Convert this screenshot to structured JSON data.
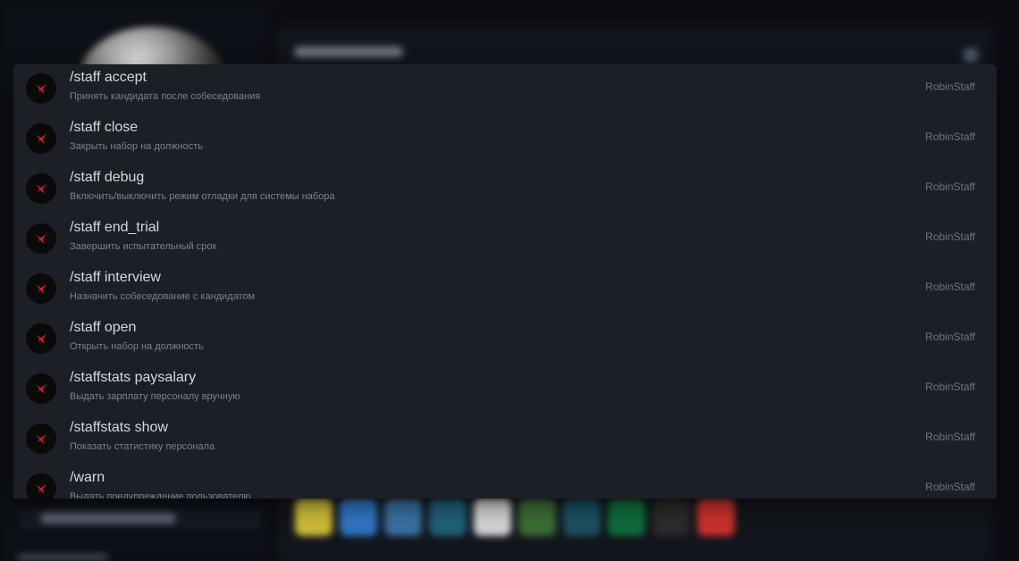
{
  "autocomplete": {
    "commands": [
      {
        "name": "/staff accept",
        "description": "Принять кандидата после собеседования",
        "source": "RobinStaff"
      },
      {
        "name": "/staff close",
        "description": "Закрыть набор на должность",
        "source": "RobinStaff"
      },
      {
        "name": "/staff debug",
        "description": "Включить/выключить режим отладки для системы набора",
        "source": "RobinStaff"
      },
      {
        "name": "/staff end_trial",
        "description": "Завершить испытательный срок",
        "source": "RobinStaff"
      },
      {
        "name": "/staff interview",
        "description": "Назначить собеседование с кандидатом",
        "source": "RobinStaff"
      },
      {
        "name": "/staff open",
        "description": "Открыть набор на должность",
        "source": "RobinStaff"
      },
      {
        "name": "/staffstats paysalary",
        "description": "Выдать зарплату персоналу вручную",
        "source": "RobinStaff"
      },
      {
        "name": "/staffstats show",
        "description": "Показать статистику персонала",
        "source": "RobinStaff"
      },
      {
        "name": "/warn",
        "description": "Выдать предупреждение пользователю",
        "source": "RobinStaff"
      }
    ],
    "bot_icon": "red-bird-logo-icon",
    "accent_color": "#d11a2a"
  },
  "background": {
    "tech_icons": [
      {
        "icon": "javascript-icon",
        "color": "#c9b937"
      },
      {
        "icon": "typescript-icon",
        "color": "#2f74c0"
      },
      {
        "icon": "python-icon",
        "color": "#3a6e9e"
      },
      {
        "icon": "react-icon",
        "color": "#1f5f78"
      },
      {
        "icon": "github-icon",
        "color": "#d0d0d0"
      },
      {
        "icon": "nodejs-icon",
        "color": "#3b6b35"
      },
      {
        "icon": "go-icon",
        "color": "#1b4f5e"
      },
      {
        "icon": "mongodb-icon",
        "color": "#0f6b3a"
      },
      {
        "icon": "linux-icon",
        "color": "#2a2a2a"
      },
      {
        "icon": "redis-icon",
        "color": "#c8302c"
      }
    ]
  }
}
